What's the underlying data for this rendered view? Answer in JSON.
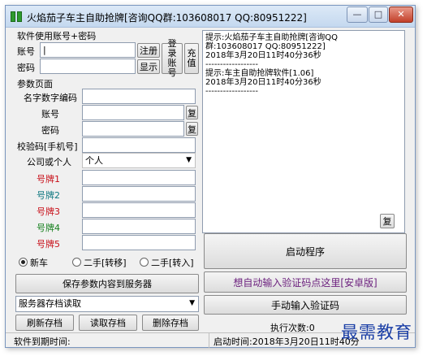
{
  "window": {
    "title": "火焰茄子车主自助抢牌[咨询QQ群:103608017 QQ:80951222]",
    "minimize": "—",
    "maximize": "□",
    "close": "✕"
  },
  "account": {
    "group_label": "软件使用账号+密码",
    "account_label": "账号",
    "password_label": "密码",
    "account_value": "|",
    "register_button": "注册",
    "show_button": "显示",
    "login_button": "登录账号",
    "recharge_button": "充值"
  },
  "params": {
    "group_label": "参数页面",
    "name_code_label": "名字数字编码",
    "account_label": "账号",
    "password_label": "密码",
    "verify_label": "校验码[手机号]",
    "company_label": "公司或个人",
    "company_value": "个人",
    "copy1": "复",
    "copy2": "复",
    "plates": [
      {
        "label": "号牌1",
        "color": "#c8101a"
      },
      {
        "label": "号牌2",
        "color": "#107880"
      },
      {
        "label": "号牌3",
        "color": "#c8101a"
      },
      {
        "label": "号牌4",
        "color": "#16801e"
      },
      {
        "label": "号牌5",
        "color": "#c8101a"
      }
    ]
  },
  "radios": {
    "new_car": "新车",
    "used_transfer": "二手[转移]",
    "used_transfer_in": "二手[转入]"
  },
  "save_button": "保存参数内容到服务器",
  "server": {
    "select_placeholder": "服务器存档读取",
    "refresh_button": "刷新存档",
    "read_button": "读取存档",
    "delete_button": "删除存档"
  },
  "log": {
    "text": "提示:火焰茄子车主自助抢牌[咨询QQ\n群:103608017 QQ:80951222]\n2018年3月20日11时40分36秒\n------------------\n提示:车主自助抢牌软件[1.06]\n2018年3月20日11时40分36秒\n------------------",
    "copy_button": "复"
  },
  "start_button": "启动程序",
  "auto_verify_link": "想自动输入验证码点这里[安卓版]",
  "manual_verify_button": "手动输入验证码",
  "exec_count": "执行次数:0",
  "status": {
    "expiry": "软件到期时间:",
    "start_time": "启动时间:2018年3月20日11时40分"
  },
  "watermark": "最需教育"
}
